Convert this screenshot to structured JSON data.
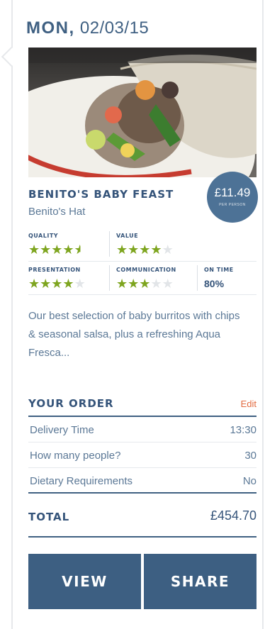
{
  "date": {
    "day": "MON,",
    "value": "02/03/15"
  },
  "dish": {
    "title": "BENITO'S BABY FEAST",
    "vendor": "Benito's Hat",
    "price": "£11.49",
    "price_caption": "PER PERSON",
    "image_icon": "burrito-photo"
  },
  "ratings": {
    "quality": {
      "label": "QUALITY",
      "score": 4.5,
      "max": 5
    },
    "value": {
      "label": "VALUE",
      "score": 4,
      "max": 5
    },
    "presentation": {
      "label": "PRESENTATION",
      "score": 4,
      "max": 5
    },
    "communication": {
      "label": "COMMUNICATION",
      "score": 3,
      "max": 5
    },
    "on_time": {
      "label": "ON TIME",
      "value": "80%"
    }
  },
  "description": "Our best selection of baby burritos with chips & seasonal salsa, plus a refreshing Aqua Fresca...",
  "order": {
    "title": "YOUR ORDER",
    "edit_label": "Edit",
    "rows": [
      {
        "label": "Delivery Time",
        "value": "13:30"
      },
      {
        "label": "How many people?",
        "value": "30"
      },
      {
        "label": "Dietary Requirements",
        "value": "No"
      }
    ]
  },
  "total": {
    "label": "TOTAL",
    "value": "£454.70"
  },
  "actions": {
    "view_label": "VIEW",
    "share_label": "SHARE"
  },
  "colors": {
    "primary": "#3d5f82",
    "accent": "#e2693e",
    "star": "#7ea51f"
  }
}
